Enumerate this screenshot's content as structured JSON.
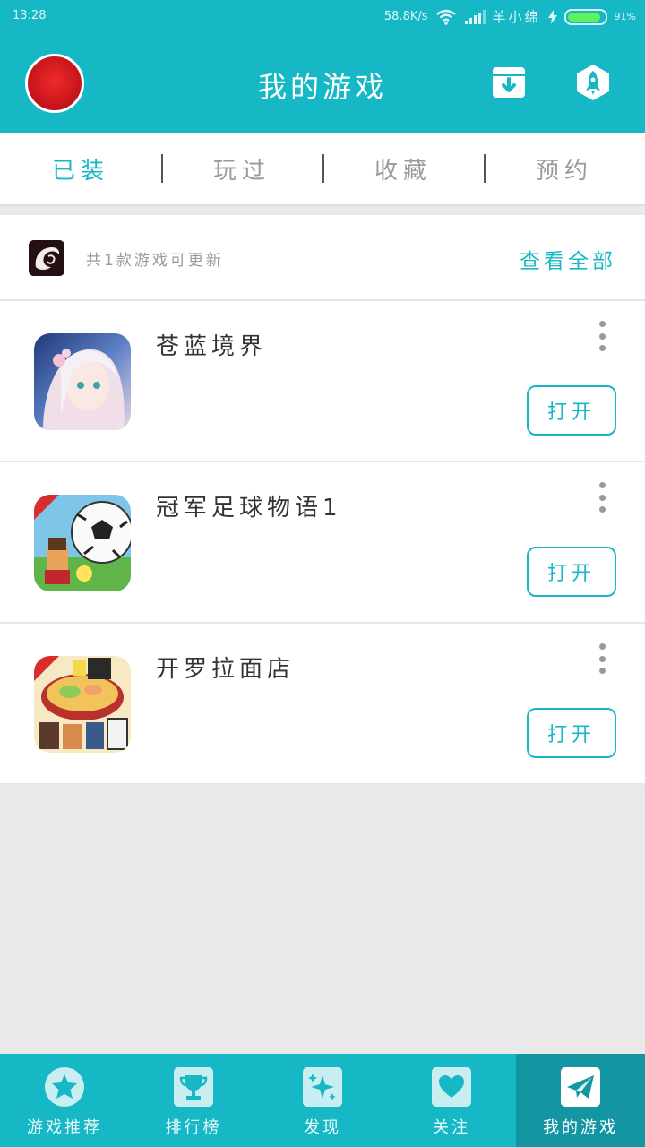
{
  "status_bar": {
    "time": "13:28",
    "speed": "58.8K/s",
    "carrier": "羊小绵",
    "battery_percent": "91%",
    "battery_level": 0.91
  },
  "header": {
    "title": "我的游戏",
    "icons": [
      "avatar",
      "download-box-icon",
      "rocket-icon"
    ]
  },
  "tabs": [
    {
      "label": "已装",
      "active": true
    },
    {
      "label": "玩过",
      "active": false
    },
    {
      "label": "收藏",
      "active": false
    },
    {
      "label": "预约",
      "active": false
    }
  ],
  "updates": {
    "text": "共1款游戏可更新",
    "view_all": "查看全部"
  },
  "games": [
    {
      "name": "苍蓝境界",
      "action": "打开"
    },
    {
      "name": "冠军足球物语1",
      "action": "打开"
    },
    {
      "name": "开罗拉面店",
      "action": "打开"
    }
  ],
  "bottom_nav": [
    {
      "label": "游戏推荐",
      "icon": "star-icon",
      "active": false
    },
    {
      "label": "排行榜",
      "icon": "trophy-icon",
      "active": false
    },
    {
      "label": "发现",
      "icon": "sparkle-icon",
      "active": false
    },
    {
      "label": "关注",
      "icon": "heart-icon",
      "active": false
    },
    {
      "label": "我的游戏",
      "icon": "paper-plane-icon",
      "active": true
    }
  ],
  "colors": {
    "accent": "#17b8c6",
    "nav_active": "#1496a2",
    "battery": "#5cf35f"
  }
}
